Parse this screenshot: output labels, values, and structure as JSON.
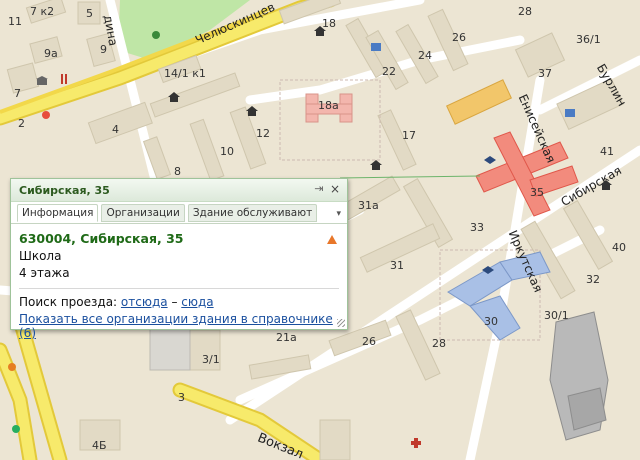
{
  "map": {
    "streets": {
      "chelyuskintsev": "Челюскинцев",
      "eniseyskaya": "Енисейская",
      "sibirskaya": "Сибирская",
      "irkutskaya": "Иркутская",
      "burlinskaya": "Бурлин",
      "vokzalnaya": "Вокзал",
      "top_partial": "дина"
    },
    "house_numbers": [
      "7 к2",
      "5",
      "11",
      "9а",
      "9",
      "7",
      "14/1 к1",
      "18",
      "26",
      "28",
      "36/1",
      "22",
      "24",
      "37",
      "2",
      "4",
      "18а",
      "17",
      "10",
      "12",
      "41",
      "8",
      "35",
      "31а",
      "33",
      "40",
      "31",
      "32",
      "30",
      "30/1",
      "28",
      "26",
      "3/1",
      "21а",
      "3",
      "4Б"
    ]
  },
  "popup": {
    "title": "Сибирская, 35",
    "tabs": [
      "Информация",
      "Организации",
      "Здание обслуживают"
    ],
    "address": "630004, Сибирская, 35",
    "type": "Школа",
    "floors": "4 этажа",
    "route_label": "Поиск проезда:",
    "route_from": "отсюда",
    "route_dash": "–",
    "route_to": "сюда",
    "show_all": "Показать все организации здания в справочнике (6)"
  },
  "colors": {
    "highlight_building": "#f28b7d",
    "road_yellow": "#f5e24f",
    "accent_green": "#2c5a1f"
  }
}
